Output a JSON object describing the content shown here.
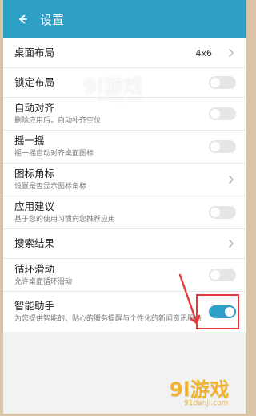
{
  "header": {
    "title": "设置",
    "back_icon": "back-arrow-icon"
  },
  "settings": {
    "items": [
      {
        "label": "桌面布局",
        "value": "4x6",
        "control": "chevron"
      },
      {
        "label": "锁定布局",
        "control": "toggle",
        "state": "off"
      },
      {
        "label": "自动对齐",
        "subtitle": "删除应用后，自动补齐空位",
        "control": "toggle",
        "state": "off"
      },
      {
        "label": "摇一摇",
        "subtitle": "摇一摇自动对齐桌面图标",
        "control": "toggle",
        "state": "off"
      },
      {
        "label": "图标角标",
        "subtitle": "设置是否显示图标角标",
        "control": "chevron"
      },
      {
        "label": "应用建议",
        "subtitle": "基于您的使用习惯向您推荐应用",
        "control": "toggle",
        "state": "off"
      },
      {
        "label": "搜索结果",
        "control": "chevron"
      },
      {
        "label": "循环滑动",
        "subtitle": "允许桌面循环滑动",
        "control": "toggle",
        "state": "off"
      },
      {
        "label": "智能助手",
        "subtitle": "为您提供智能的、贴心的服务提醒与个性化的新闻资讯服务",
        "control": "toggle",
        "state": "on"
      }
    ]
  },
  "watermark": {
    "top_main": "9l游戏",
    "top_sub": "91danji.com",
    "bottom_main": "9l游戏",
    "bottom_sub": "91danji.com"
  },
  "colors": {
    "header": "#2ea0c8",
    "toggle_on": "#2ea0c8",
    "highlight": "#e23b3b",
    "background": "#f2f2f2"
  }
}
